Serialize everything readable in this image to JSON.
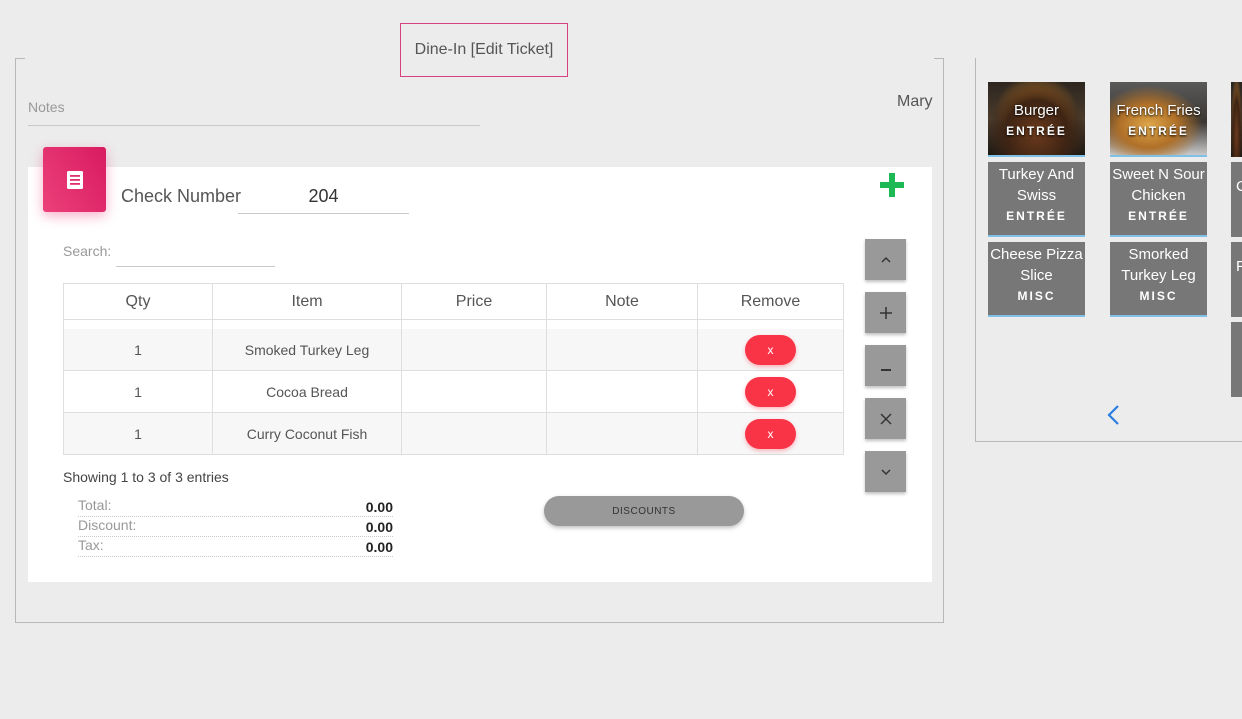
{
  "header": {
    "legend_title": "Dine-In [Edit Ticket]",
    "notes_label": "Notes",
    "user_name": "Mary"
  },
  "ticket": {
    "check_number_label": "Check Number",
    "check_number": "204",
    "search_label": "Search:",
    "search_value": ""
  },
  "table": {
    "columns": [
      "Qty",
      "Item",
      "Price",
      "Note",
      "Remove"
    ],
    "rows": [
      {
        "qty": "1",
        "item": "Smoked Turkey Leg",
        "price": "",
        "note": "",
        "remove": "x"
      },
      {
        "qty": "1",
        "item": "Cocoa Bread",
        "price": "",
        "note": "",
        "remove": "x"
      },
      {
        "qty": "1",
        "item": "Curry Coconut Fish",
        "price": "",
        "note": "",
        "remove": "x"
      }
    ],
    "entries_info": "Showing 1 to 3 of 3 entries"
  },
  "totals": {
    "total_label": "Total:",
    "total_value": "0.00",
    "discount_label": "Discount:",
    "discount_value": "0.00",
    "tax_label": "Tax:",
    "tax_value": "0.00"
  },
  "buttons": {
    "discounts": "DISCOUNTS"
  },
  "menu": {
    "tiles": [
      {
        "name": "Burger",
        "category": "ENTRÉE"
      },
      {
        "name": "French Fries",
        "category": "ENTRÉE"
      },
      {
        "name": "Turkey And Swiss",
        "category": "ENTRÉE"
      },
      {
        "name": "Sweet N Sour Chicken",
        "category": "ENTRÉE"
      },
      {
        "name": "Cheese Pizza Slice",
        "category": "MISC"
      },
      {
        "name": "Smorked Turkey Leg",
        "category": "MISC"
      }
    ],
    "partial_letters": [
      "C",
      "F"
    ]
  },
  "colors": {
    "accent_pink": "#e91e63",
    "remove_red": "#fa3447",
    "add_green": "#1db954",
    "tile_gray": "#777777",
    "nav_blue": "#2a7de1"
  }
}
